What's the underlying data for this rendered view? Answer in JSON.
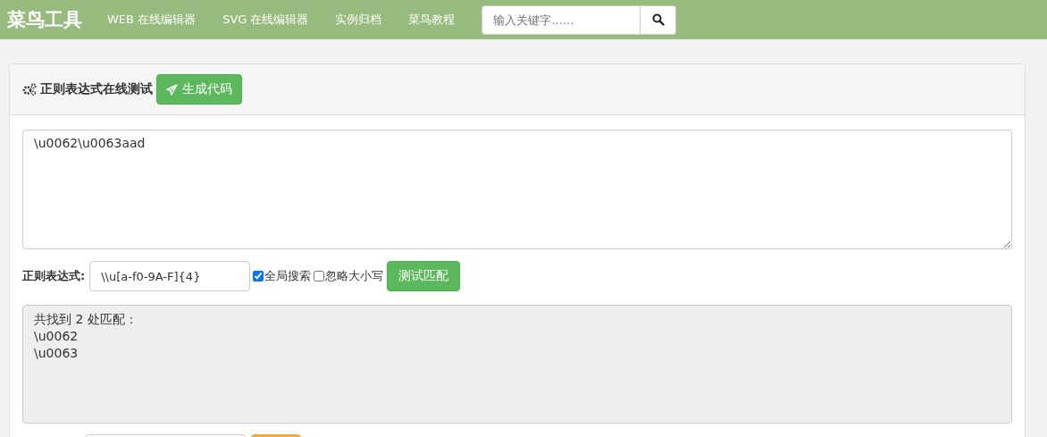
{
  "navbar": {
    "brand": "菜鸟工具",
    "links": [
      "WEB 在线编辑器",
      "SVG 在线编辑器",
      "实例归档",
      "菜鸟教程"
    ],
    "search": {
      "placeholder": "输入关键字......"
    }
  },
  "panel": {
    "title": "正则表达式在线测试",
    "generate_button": "生成代码"
  },
  "input_text": "\\u0062\\u0063aad",
  "regex": {
    "label": "正则表达式:",
    "value": "\\\\u[a-f0-9A-F]{4}",
    "options": [
      {
        "label": "全局搜索",
        "checked": true
      },
      {
        "label": "忽略大小写",
        "checked": false
      }
    ],
    "test_button": "测试匹配"
  },
  "result_lines": [
    "共找到 2 处匹配：",
    "\\u0062",
    "\\u0063"
  ]
}
